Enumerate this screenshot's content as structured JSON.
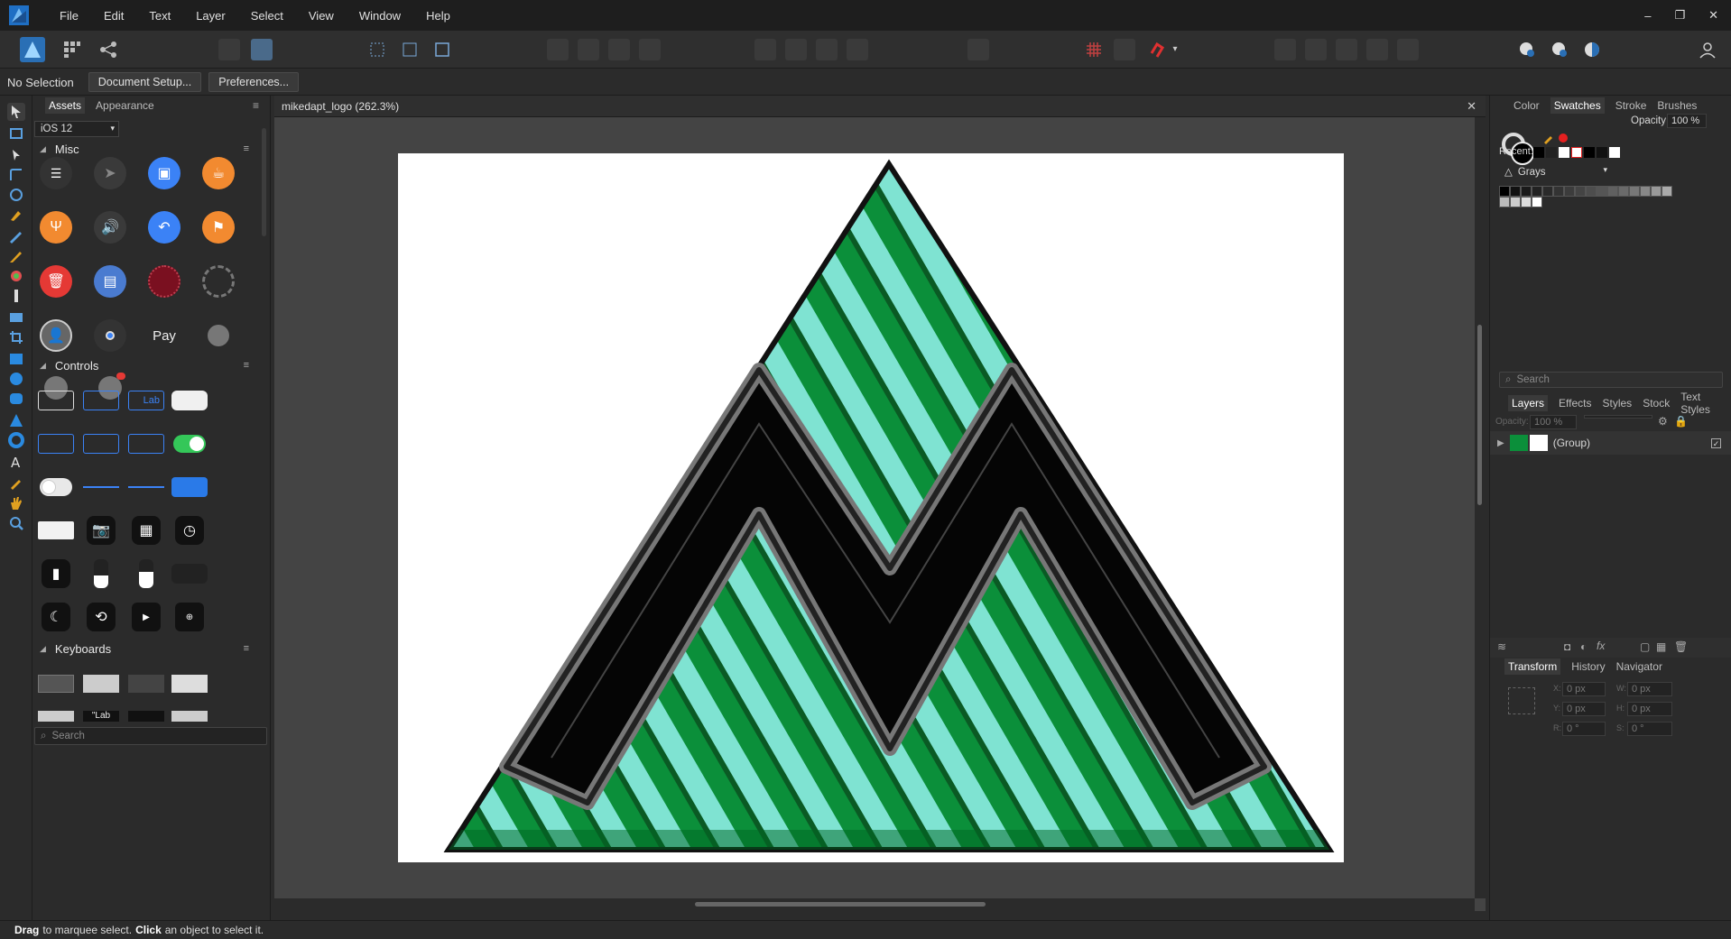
{
  "menubar": {
    "items": [
      "File",
      "Edit",
      "Text",
      "Layer",
      "Select",
      "View",
      "Window",
      "Help"
    ],
    "window_controls": [
      "–",
      "❐",
      "✕"
    ]
  },
  "context": {
    "selection": "No Selection",
    "document_setup": "Document Setup...",
    "preferences": "Preferences..."
  },
  "assets_panel": {
    "tabs": [
      "Assets",
      "Appearance"
    ],
    "category": "iOS 12",
    "sections": [
      "Misc",
      "Controls",
      "Keyboards"
    ],
    "search_placeholder": "Search",
    "controls_label_fragment": "Lab",
    "keyboard_label_fragment": "\"Lab"
  },
  "document": {
    "title": "mikedapt_logo (262.3%)",
    "close_glyph": "✕"
  },
  "color_panel": {
    "tabs": [
      "Color",
      "Swatches",
      "Stroke",
      "Brushes"
    ],
    "opacity_label": "Opacity:",
    "opacity_value": "100 %",
    "recent_label": "Recent:",
    "palette": "Grays",
    "search_placeholder": "Search"
  },
  "layers_panel": {
    "tabs": [
      "Layers",
      "Effects",
      "Styles",
      "Stock",
      "Text Styles"
    ],
    "opacity_label": "Opacity:",
    "opacity_value": "100 %",
    "layer_name": "(Group)"
  },
  "transform_panel": {
    "tabs": [
      "Transform",
      "History",
      "Navigator"
    ],
    "x_label": "X:",
    "y_label": "Y:",
    "w_label": "W:",
    "h_label": "H:",
    "r_label": "R:",
    "s_label": "S:",
    "x": "0 px",
    "y": "0 px",
    "w": "0 px",
    "h": "0 px",
    "r": "0 °",
    "s": "0 °"
  },
  "status": {
    "drag": "Drag",
    "drag_text": "to marquee select.",
    "click": "Click",
    "click_text": "an object to select it."
  },
  "colors": {
    "accent": "#2a6fb5",
    "logo_green": "#0b8f3a",
    "logo_mint": "#7fe3d2",
    "logo_black": "#050505"
  }
}
